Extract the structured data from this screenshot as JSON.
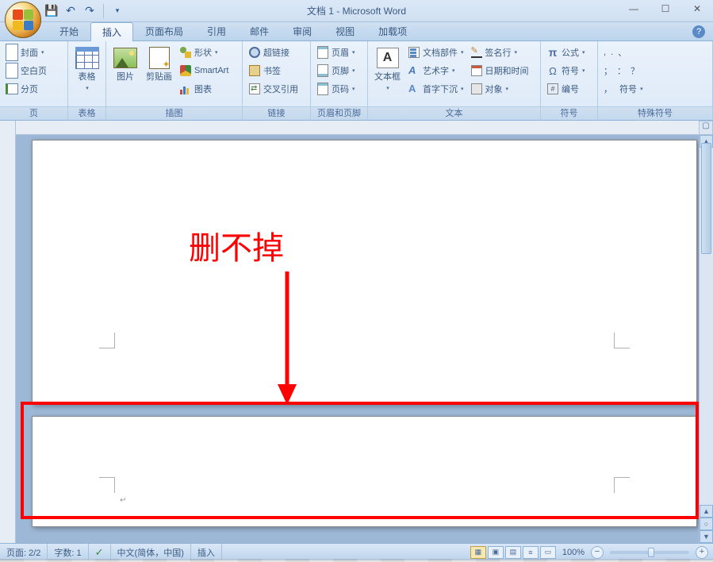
{
  "title": "文档 1 - Microsoft Word",
  "tabs": [
    "开始",
    "插入",
    "页面布局",
    "引用",
    "邮件",
    "审阅",
    "视图",
    "加载项"
  ],
  "active_tab": 1,
  "ribbon": {
    "pages": {
      "label": "页",
      "cover": "封面",
      "blank": "空白页",
      "break": "分页"
    },
    "tables": {
      "label": "表格",
      "table": "表格"
    },
    "illustrations": {
      "label": "插图",
      "picture": "图片",
      "clipart": "剪贴画",
      "shapes": "形状",
      "smartart": "SmartArt",
      "chart": "图表"
    },
    "links": {
      "label": "链接",
      "hyperlink": "超链接",
      "bookmark": "书签",
      "crossref": "交叉引用"
    },
    "headerfooter": {
      "label": "页眉和页脚",
      "header": "页眉",
      "footer": "页脚",
      "pagenum": "页码"
    },
    "text": {
      "label": "文本",
      "textbox": "文本框",
      "parts": "文档部件",
      "wordart": "艺术字",
      "dropcap": "首字下沉",
      "signature": "签名行",
      "datetime": "日期和时间",
      "object": "对象"
    },
    "symbols": {
      "label": "符号",
      "equation": "公式",
      "symbol": "符号",
      "number": "编号"
    },
    "special": {
      "label": "特殊符号",
      "sym": "符号"
    }
  },
  "annotation": "删不掉",
  "status": {
    "page": "页面: 2/2",
    "words": "字数: 1",
    "lang": "中文(简体，中国)",
    "mode": "插入",
    "zoom": "100%"
  },
  "special_chars": [
    ",",
    ".",
    "、",
    "；",
    "：",
    "？",
    "，",
    "符号"
  ]
}
